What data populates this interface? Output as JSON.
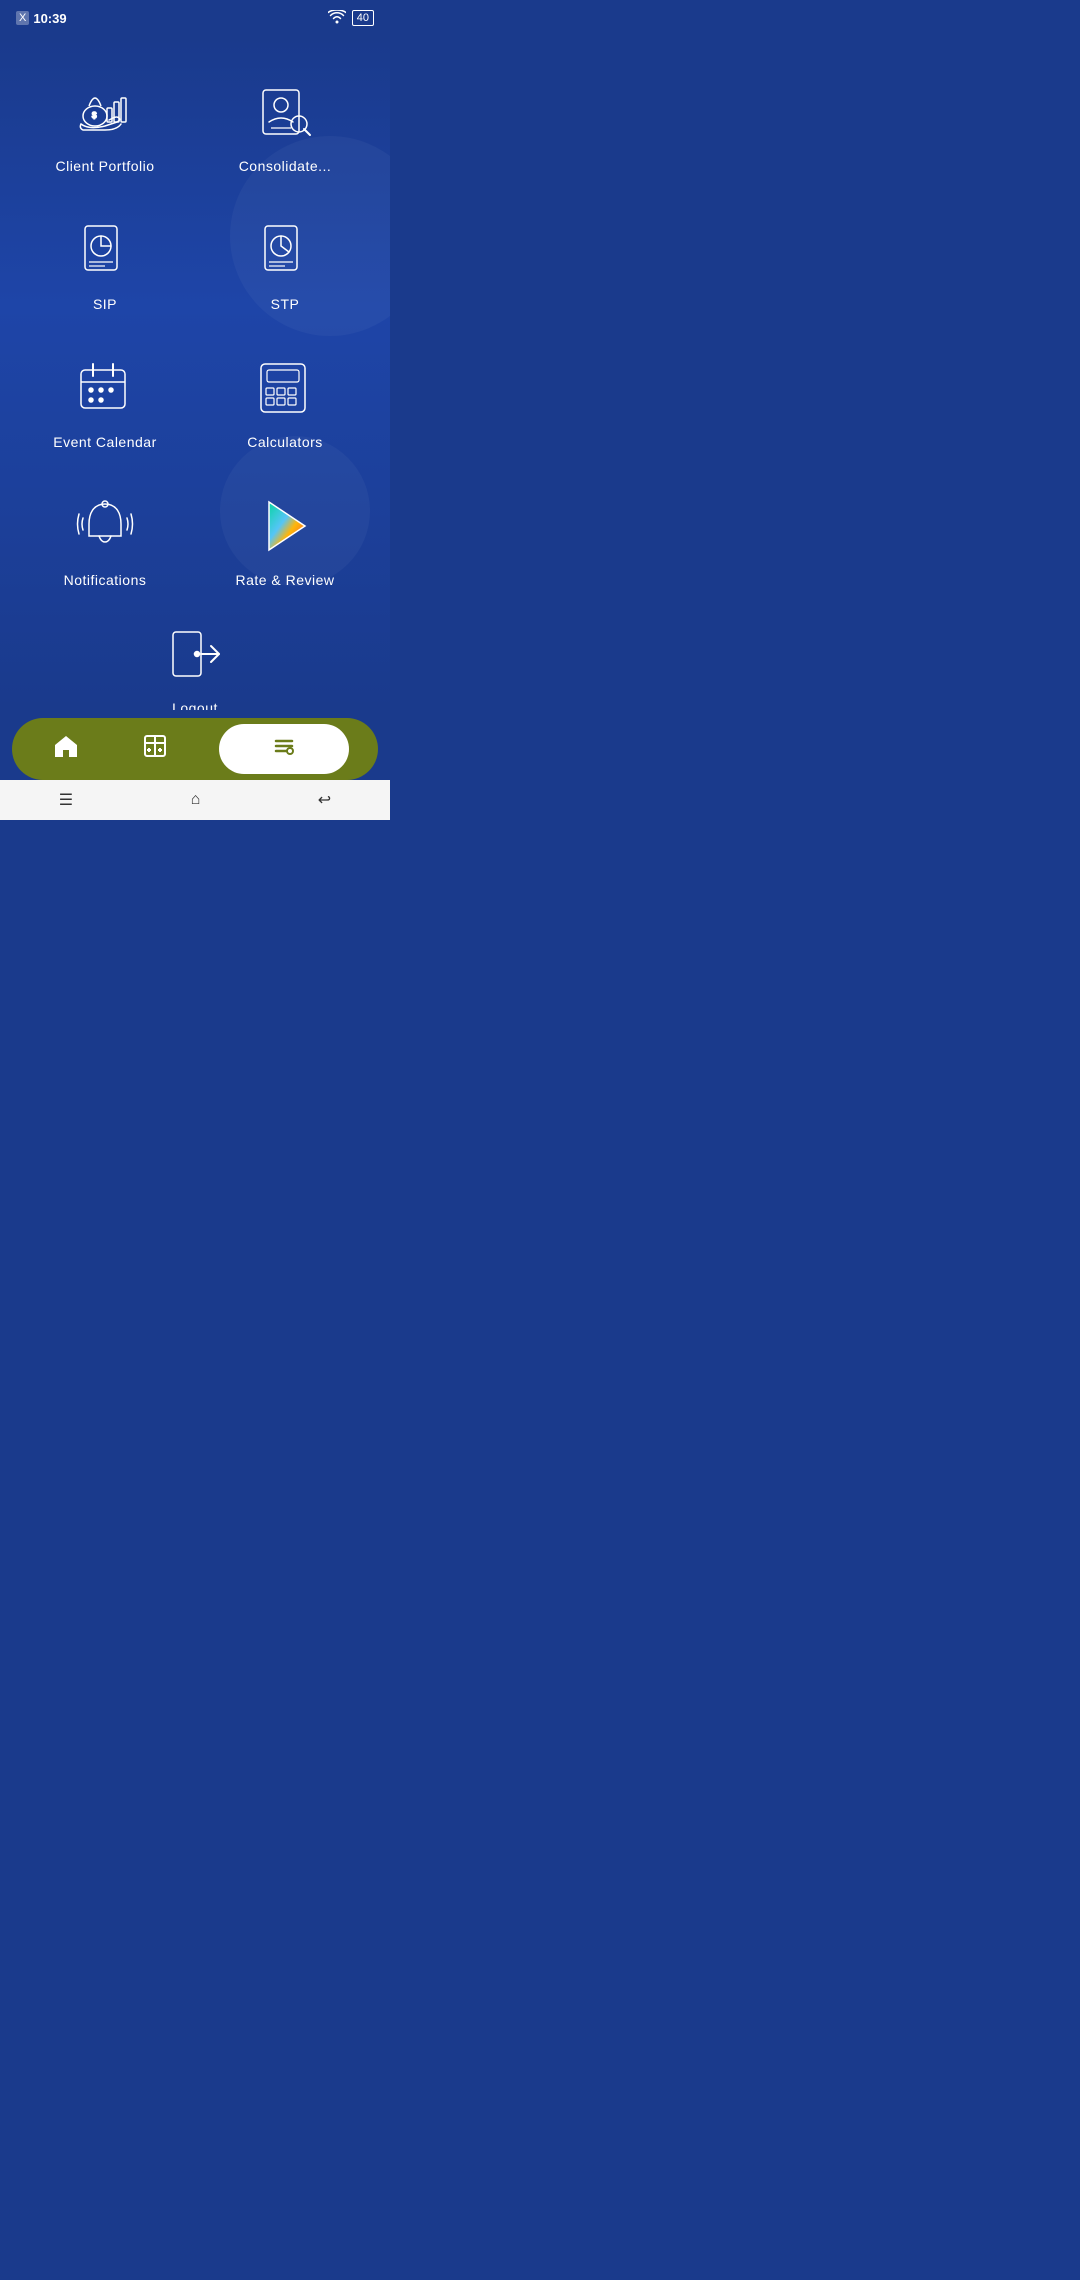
{
  "status": {
    "time": "10:39",
    "battery": "40",
    "x_label": "X"
  },
  "menu": {
    "items": [
      {
        "id": "client-portfolio",
        "label": "Client Portfolio",
        "icon": "portfolio"
      },
      {
        "id": "consolidate",
        "label": "Consolidate...",
        "icon": "consolidate"
      },
      {
        "id": "sip",
        "label": "SIP",
        "icon": "sip"
      },
      {
        "id": "stp",
        "label": "STP",
        "icon": "stp"
      },
      {
        "id": "event-calendar",
        "label": "Event Calendar",
        "icon": "calendar"
      },
      {
        "id": "calculators",
        "label": "Calculators",
        "icon": "calculator"
      },
      {
        "id": "notifications",
        "label": "Notifications",
        "icon": "bell"
      },
      {
        "id": "rate-review",
        "label": "Rate & Review",
        "icon": "play"
      }
    ],
    "logout": {
      "id": "logout",
      "label": "Logout",
      "icon": "logout"
    }
  },
  "bottom_nav": {
    "home_label": "home",
    "calculator_label": "calculator",
    "menu_label": "menu"
  }
}
